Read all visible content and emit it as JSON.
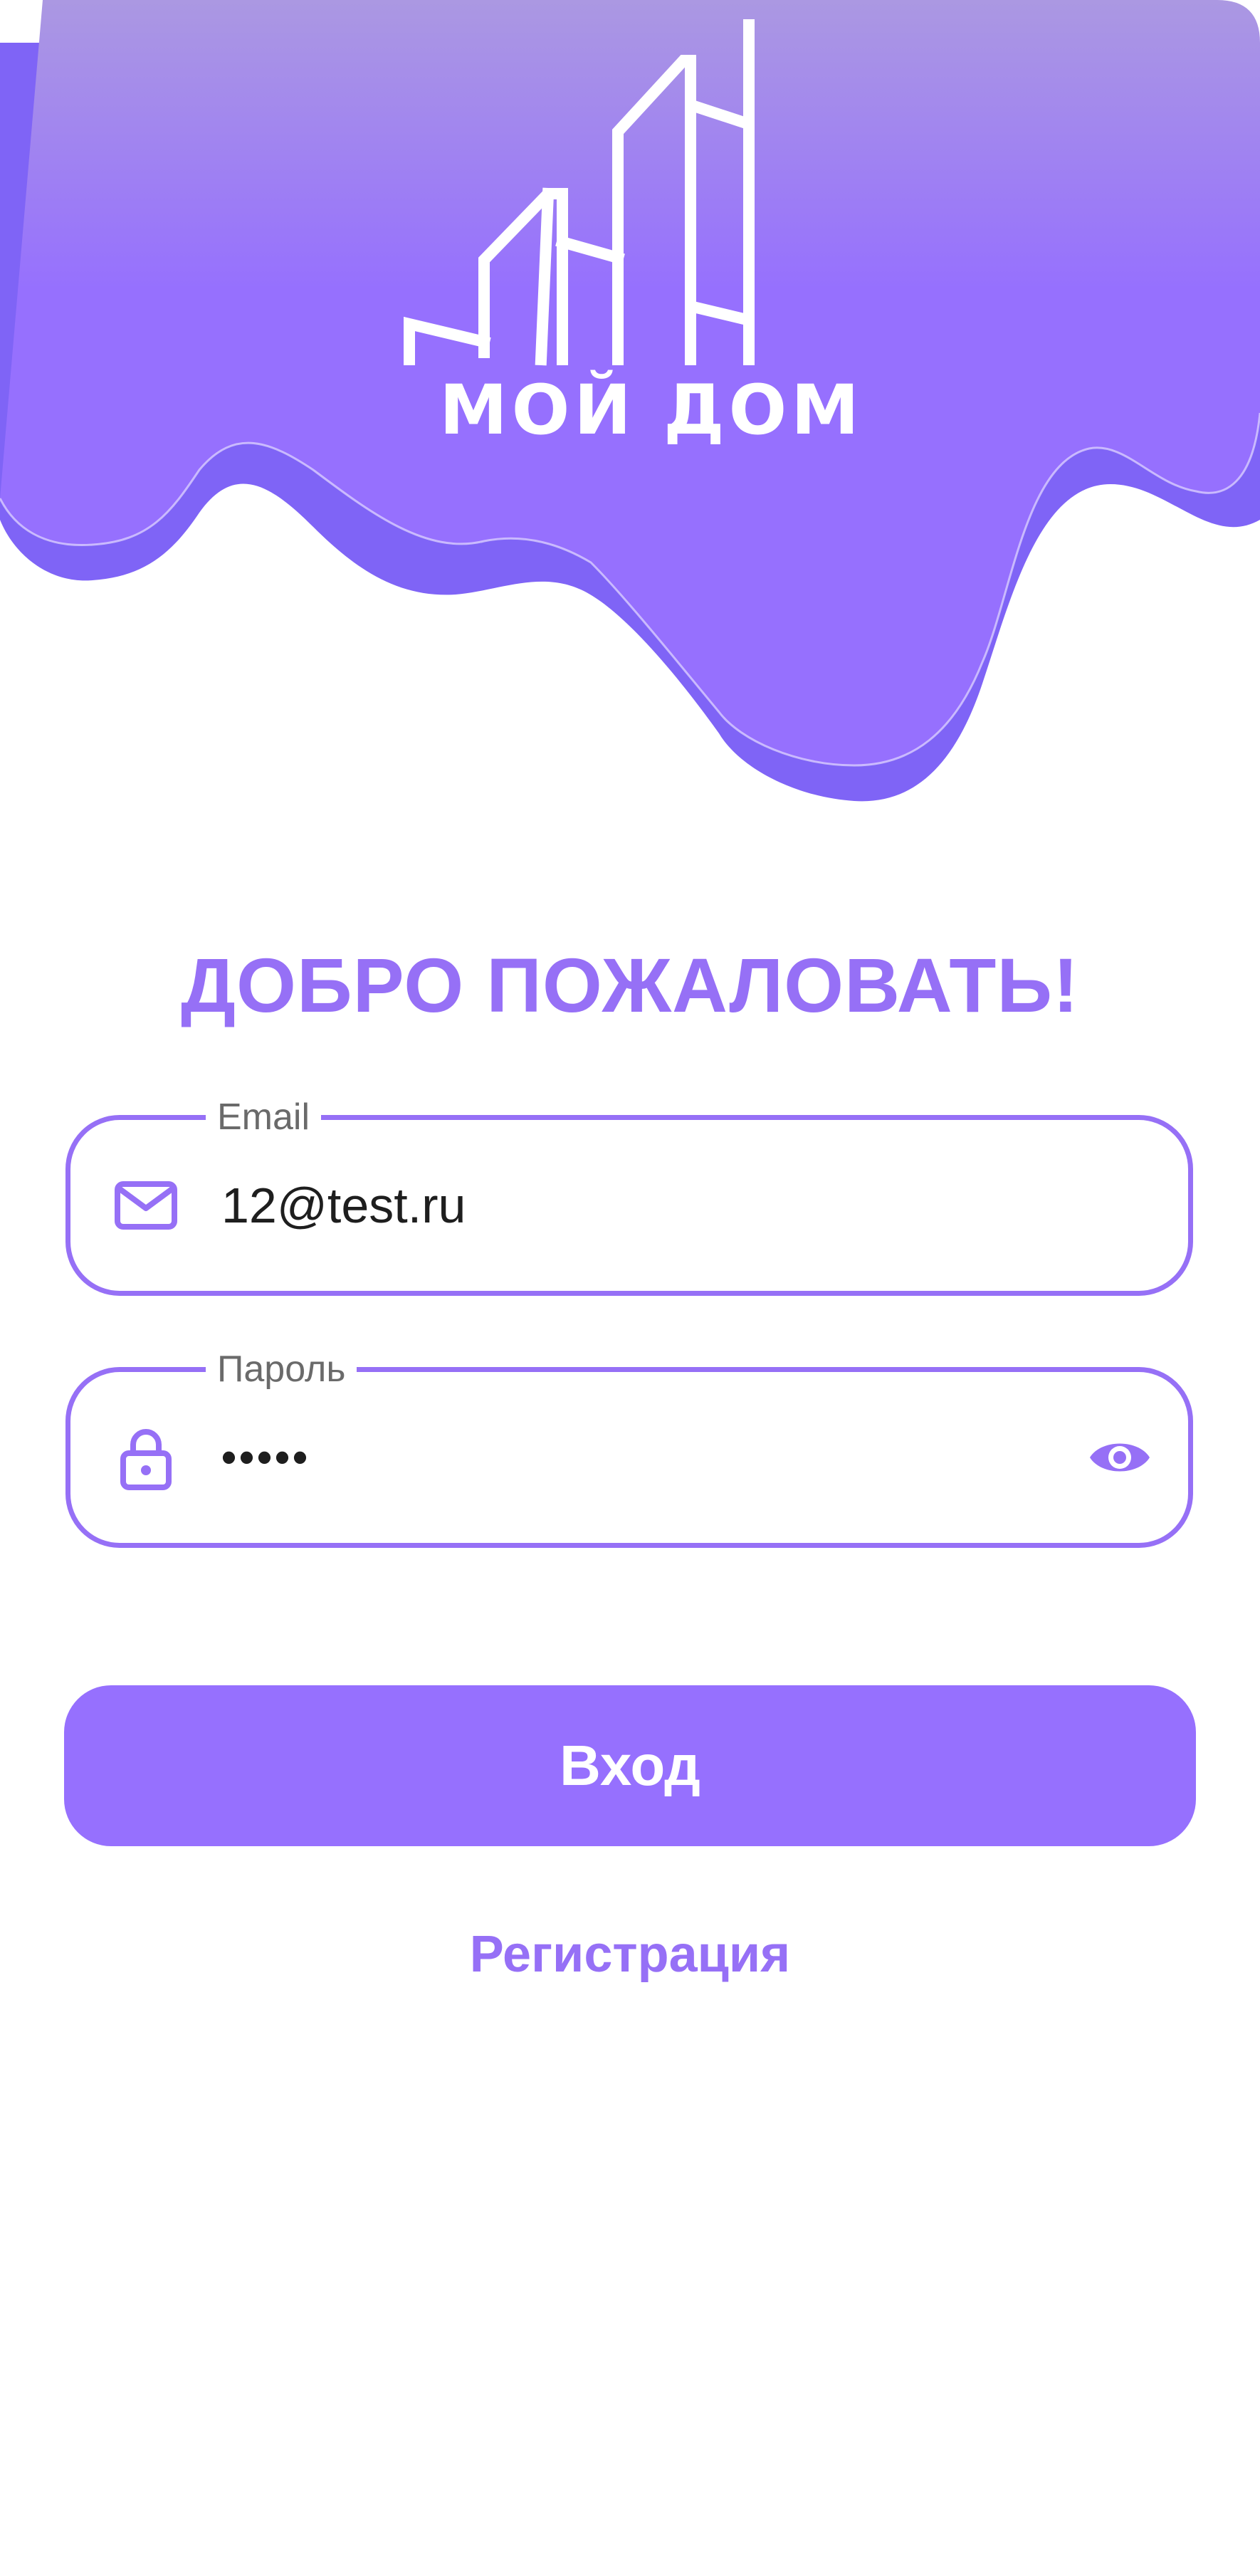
{
  "header": {
    "logo_text": "МОЙ ДОМ"
  },
  "welcome": {
    "title": "ДОБРО ПОЖАЛОВАТЬ!"
  },
  "email_field": {
    "label": "Email",
    "value": "12@test.ru",
    "icon": "mail-icon"
  },
  "password_field": {
    "label": "Пароль",
    "value": "•••••",
    "icon": "lock-icon",
    "toggle_icon": "eye-icon"
  },
  "login_button": {
    "label": "Вход"
  },
  "register_link": {
    "label": "Регистрация"
  },
  "colors": {
    "accent": "#9670f6",
    "accent_dark": "#7f64f6",
    "header_top": "#ab98e2",
    "background": "#ffffff"
  }
}
